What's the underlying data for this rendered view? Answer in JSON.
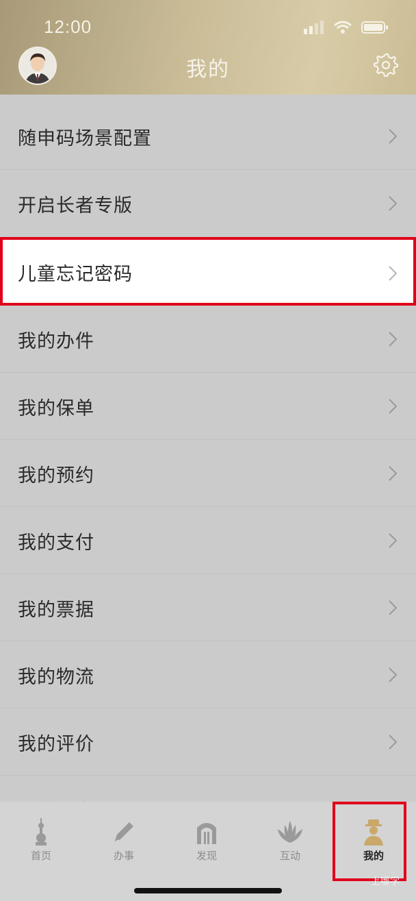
{
  "status_bar": {
    "time": "12:00"
  },
  "header": {
    "title": "我的"
  },
  "menu": {
    "items": [
      {
        "label": "随申码场景配置"
      },
      {
        "label": "开启长者专版"
      },
      {
        "label": "儿童忘记密码"
      },
      {
        "label": "我的办件"
      },
      {
        "label": "我的保单"
      },
      {
        "label": "我的预约"
      },
      {
        "label": "我的支付"
      },
      {
        "label": "我的票据"
      },
      {
        "label": "我的物流"
      },
      {
        "label": "我的评价"
      },
      {
        "label": "我的诉求"
      }
    ]
  },
  "tabbar": {
    "tabs": [
      {
        "label": "首页",
        "icon": "tower-icon"
      },
      {
        "label": "办事",
        "icon": "pen-icon"
      },
      {
        "label": "发现",
        "icon": "arch-icon"
      },
      {
        "label": "互动",
        "icon": "magnolia-icon"
      },
      {
        "label": "我的",
        "icon": "person-icon"
      }
    ],
    "active": "我的"
  },
  "watermark": "上哪学",
  "colors": {
    "highlight_border": "#e0001a",
    "header_gold": "#c9bc97"
  }
}
